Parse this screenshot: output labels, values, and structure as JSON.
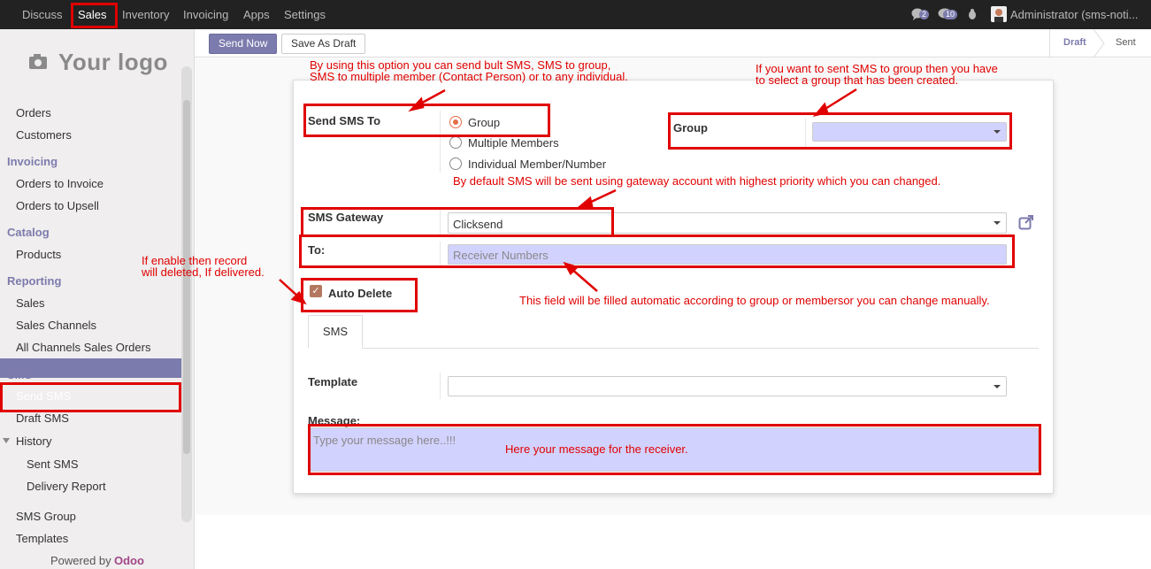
{
  "topbar": {
    "menu": [
      "Discuss",
      "Sales",
      "Inventory",
      "Invoicing",
      "Apps",
      "Settings"
    ],
    "chat_count": "2",
    "activity_count": "10",
    "user": "Administrator (sms-noti..."
  },
  "sidebar": {
    "logo": "Your logo",
    "orders": "Orders",
    "customers": "Customers",
    "invoicing_head": "Invoicing",
    "orders_to_invoice": "Orders to Invoice",
    "orders_to_upsell": "Orders to Upsell",
    "catalog_head": "Catalog",
    "products": "Products",
    "reporting_head": "Reporting",
    "sales": "Sales",
    "sales_channels": "Sales Channels",
    "all_channels": "All Channels Sales Orders",
    "sms_head": "SMS",
    "send_sms": "Send SMS",
    "draft_sms": "Draft SMS",
    "history": "History",
    "sent_sms": "Sent SMS",
    "delivery_report": "Delivery Report",
    "sms_group": "SMS Group",
    "templates": "Templates",
    "powered_by": "Powered by",
    "odoo": "Odoo"
  },
  "control": {
    "send_now": "Send Now",
    "save_draft": "Save As Draft",
    "status_draft": "Draft",
    "status_sent": "Sent"
  },
  "form": {
    "send_to_label": "Send SMS To",
    "radio_group": "Group",
    "radio_multiple": "Multiple Members",
    "radio_individual": "Individual Member/Number",
    "group_label": "Group",
    "gateway_label": "SMS Gateway",
    "gateway_value": "Clicksend",
    "to_label": "To:",
    "to_placeholder": "Receiver Numbers",
    "auto_delete_label": "Auto Delete",
    "tab_sms": "SMS",
    "template_label": "Template",
    "message_label": "Message:",
    "message_placeholder": "Type your message here..!!!"
  },
  "annotations": {
    "a1": "By using this option you can send bult SMS, SMS to group,\nSMS to multiple member (Contact Person) or to any individual.",
    "a2": "If you want to sent SMS to group then you have\nto select a group that has been created.",
    "a3": "By default SMS will be sent using gateway account with highest priority which you can changed.",
    "a4": "If enable then record\nwill deleted, If delivered.",
    "a5": "This field will be filled automatic according to group or membersor you can change manually.",
    "a6": "Here your message for the receiver."
  },
  "colors": {
    "accent": "#7c7bad",
    "annotation": "#e00000",
    "required_field": "#d2d2ff"
  }
}
